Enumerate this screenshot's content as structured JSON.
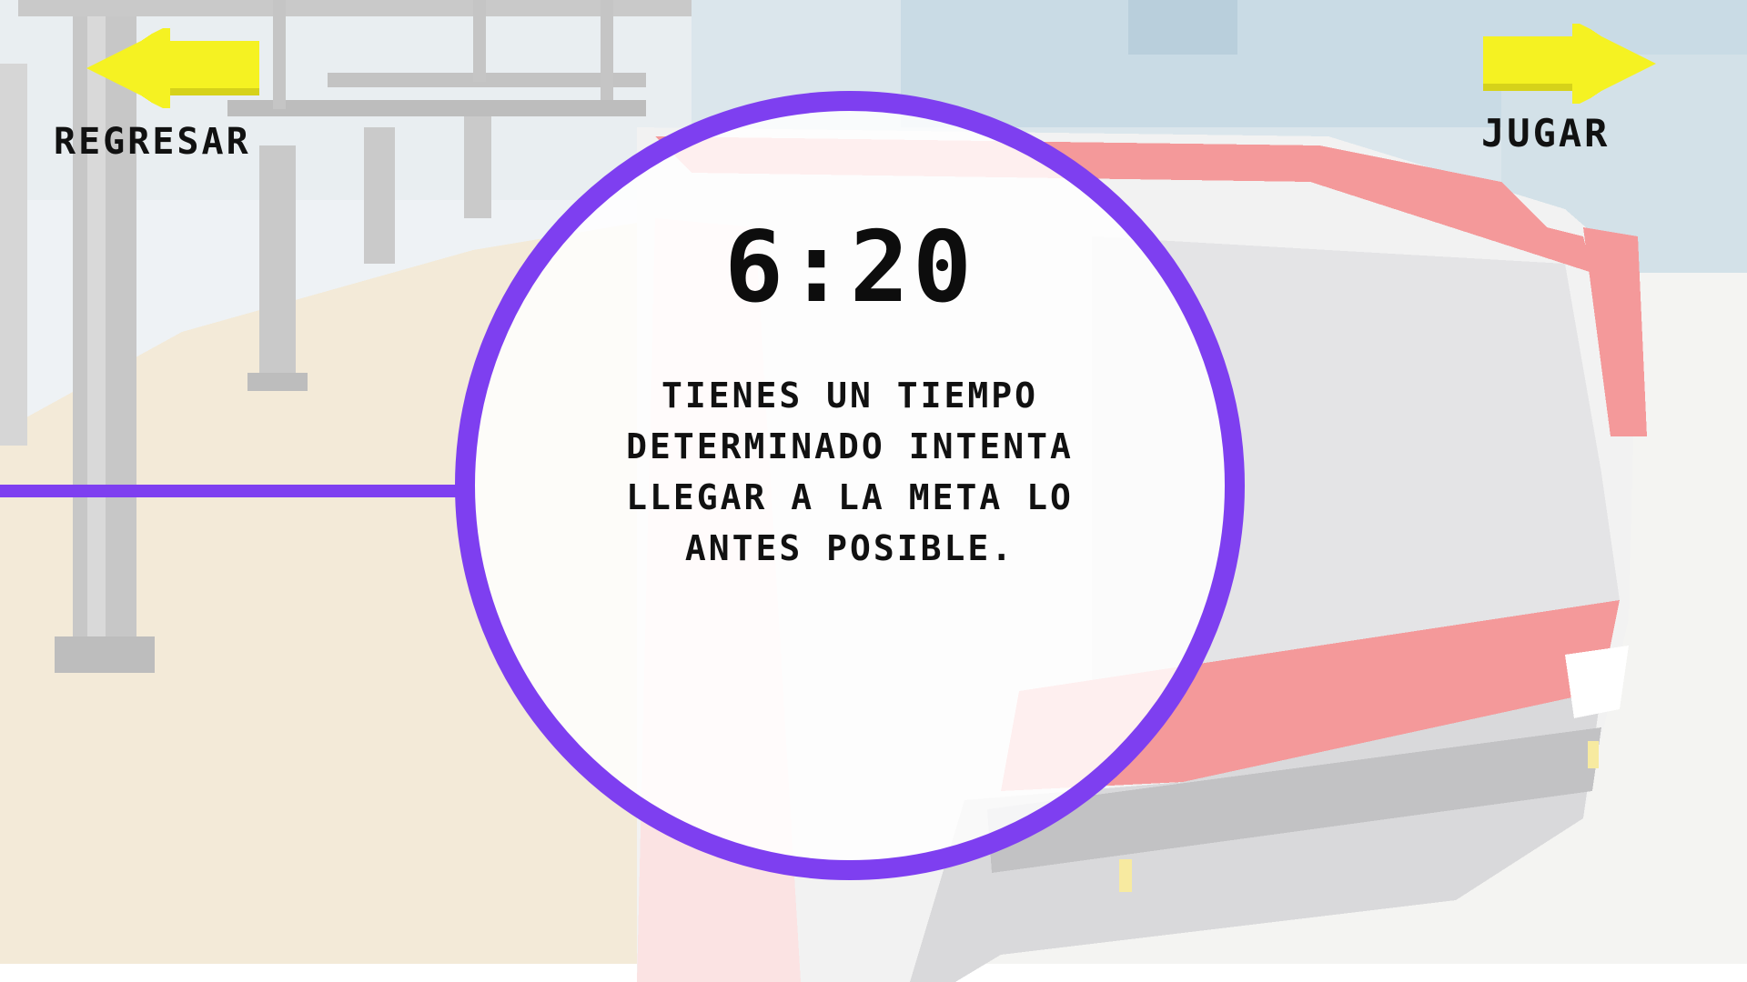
{
  "navigation": {
    "back_label": "Regresar",
    "play_label": "Jugar"
  },
  "info": {
    "timer": "6:20",
    "instructions": "Tienes un tiempo determinado intenta llegar a la meta lo antes posible."
  },
  "colors": {
    "accent": "#7e3ff0",
    "arrow": "#f5f222",
    "bus_red": "#f4999a"
  },
  "icons": {
    "back": "arrow-left-icon",
    "play": "arrow-right-icon"
  }
}
